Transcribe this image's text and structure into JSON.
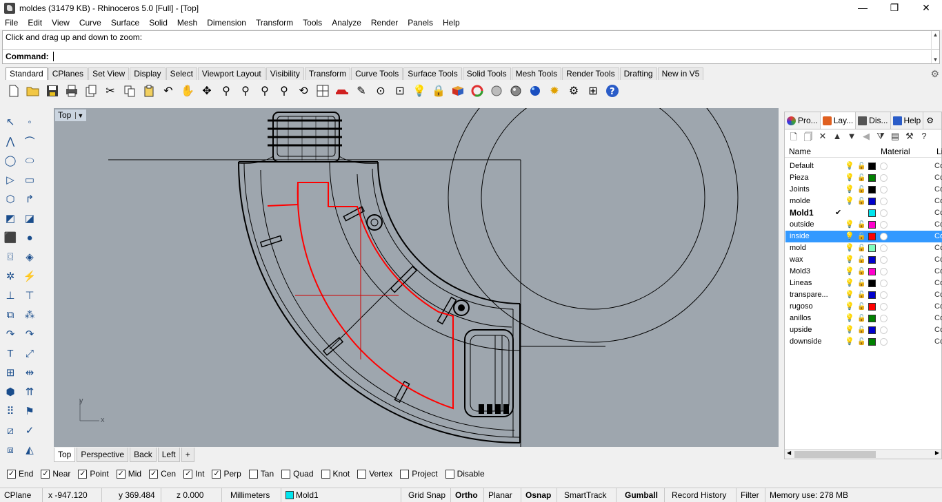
{
  "title": "moldes (31479 KB) - Rhinoceros 5.0 [Full] - [Top]",
  "window_buttons": [
    "—",
    "❐",
    "✕"
  ],
  "menu": [
    "File",
    "Edit",
    "View",
    "Curve",
    "Surface",
    "Solid",
    "Mesh",
    "Dimension",
    "Transform",
    "Tools",
    "Analyze",
    "Render",
    "Panels",
    "Help"
  ],
  "command": {
    "history": "Click and drag up and down to zoom:",
    "prompt": "Command:"
  },
  "toolbar_tabs": [
    "Standard",
    "CPlanes",
    "Set View",
    "Display",
    "Select",
    "Viewport Layout",
    "Visibility",
    "Transform",
    "Curve Tools",
    "Surface Tools",
    "Solid Tools",
    "Mesh Tools",
    "Render Tools",
    "Drafting",
    "New in V5"
  ],
  "toolbar_icons": [
    "new-file-icon",
    "open-folder-icon",
    "save-icon",
    "print-icon",
    "import-icon",
    "cut-icon",
    "copy-icon",
    "paste-icon",
    "undo-icon",
    "pan-hand-icon",
    "rotate-view-icon",
    "zoom-dynamic-icon",
    "zoom-window-icon",
    "zoom-extents-icon",
    "zoom-selected-icon",
    "rotate-3d-icon",
    "four-viewports-icon",
    "car-icon",
    "render-tools-icon",
    "osnap-icon",
    "point-edit-icon",
    "light-icon",
    "lock-icon",
    "material-icon",
    "color-wheel-icon",
    "wireframe-sphere-icon",
    "rendered-sphere-icon",
    "shaded-sphere-icon",
    "sun-icon",
    "gear-settings-icon",
    "grid-snap-icon",
    "help-icon"
  ],
  "viewport": {
    "name": "Top",
    "axis_x": "x",
    "axis_y": "y"
  },
  "viewport_tabs": [
    "Top",
    "Perspective",
    "Back",
    "Left"
  ],
  "viewport_add": "+",
  "panel": {
    "tabs": [
      "Pro...",
      "Lay...",
      "Dis...",
      "Help"
    ],
    "header_name": "Name",
    "header_material": "Material",
    "header_linetype": "Li",
    "layers": [
      {
        "name": "Default",
        "color": "#000000",
        "current": false,
        "bold": false
      },
      {
        "name": "Pieza",
        "color": "#008000",
        "current": false,
        "bold": false
      },
      {
        "name": "Joints",
        "color": "#000000",
        "current": false,
        "bold": false
      },
      {
        "name": "molde",
        "color": "#0000cc",
        "current": false,
        "bold": false
      },
      {
        "name": "Mold1",
        "color": "#00e5ee",
        "current": true,
        "bold": true
      },
      {
        "name": "outside",
        "color": "#ff00cc",
        "current": false,
        "bold": false
      },
      {
        "name": "inside",
        "color": "#ff0000",
        "current": false,
        "bold": false,
        "selected": true
      },
      {
        "name": "mold",
        "color": "#7fffbf",
        "current": false,
        "bold": false
      },
      {
        "name": "wax",
        "color": "#0000cc",
        "current": false,
        "bold": false
      },
      {
        "name": "Mold3",
        "color": "#ff00cc",
        "current": false,
        "bold": false
      },
      {
        "name": "Lineas",
        "color": "#000000",
        "current": false,
        "bold": false
      },
      {
        "name": "transpare...",
        "color": "#0000cc",
        "current": false,
        "bold": false
      },
      {
        "name": "rugoso",
        "color": "#ff0000",
        "current": false,
        "bold": false
      },
      {
        "name": "anillos",
        "color": "#008000",
        "current": false,
        "bold": false
      },
      {
        "name": "upside",
        "color": "#0000cc",
        "current": false,
        "bold": false
      },
      {
        "name": "downside",
        "color": "#008000",
        "current": false,
        "bold": false
      }
    ],
    "linetype_abbrev": "Co",
    "current_mark": "✔"
  },
  "osnaps": [
    {
      "label": "End",
      "checked": true
    },
    {
      "label": "Near",
      "checked": true
    },
    {
      "label": "Point",
      "checked": true
    },
    {
      "label": "Mid",
      "checked": true
    },
    {
      "label": "Cen",
      "checked": true
    },
    {
      "label": "Int",
      "checked": true
    },
    {
      "label": "Perp",
      "checked": true
    },
    {
      "label": "Tan",
      "checked": false
    },
    {
      "label": "Quad",
      "checked": false
    },
    {
      "label": "Knot",
      "checked": false
    },
    {
      "label": "Vertex",
      "checked": false
    },
    {
      "label": "Project",
      "checked": false
    },
    {
      "label": "Disable",
      "checked": false
    }
  ],
  "status": {
    "cplane": "CPlane",
    "x": "x -947.120",
    "y": "y 369.484",
    "z": "z 0.000",
    "units": "Millimeters",
    "layer": "Mold1",
    "grid_snap": "Grid Snap",
    "ortho": "Ortho",
    "planar": "Planar",
    "osnap": "Osnap",
    "smarttrack": "SmartTrack",
    "gumball": "Gumball",
    "record_history": "Record History",
    "filter": "Filter",
    "memory": "Memory use: 278 MB"
  }
}
